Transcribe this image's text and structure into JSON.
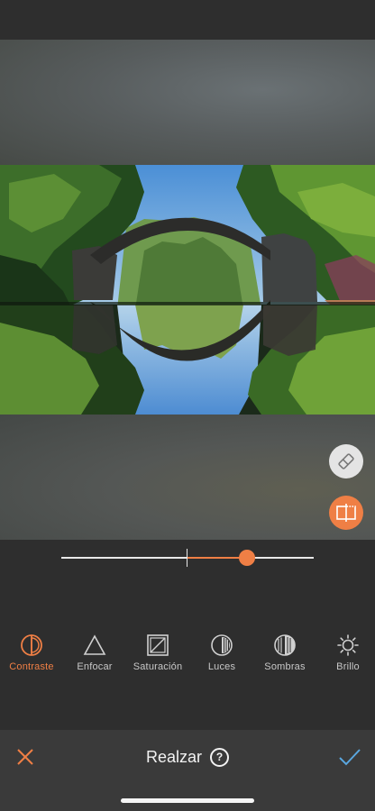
{
  "editor": {
    "photo_description": "stone arch bridge reflected in lake forming a circle",
    "slider": {
      "min": -1,
      "max": 1,
      "value": 0.47
    }
  },
  "tools": [
    {
      "label": "Contraste",
      "icon": "contrast-icon",
      "active": true
    },
    {
      "label": "Enfocar",
      "icon": "sharpen-triangle-icon",
      "active": false
    },
    {
      "label": "Saturación",
      "icon": "saturation-icon",
      "active": false
    },
    {
      "label": "Luces",
      "icon": "highlights-icon",
      "active": false
    },
    {
      "label": "Sombras",
      "icon": "shadows-icon",
      "active": false
    },
    {
      "label": "Brillo",
      "icon": "brightness-sun-icon",
      "active": false
    }
  ],
  "bottom_bar": {
    "title": "Realzar",
    "help": "?",
    "close_icon": "close-x-icon",
    "confirm_icon": "checkmark-icon"
  },
  "colors": {
    "accent": "#ef7f45",
    "confirm": "#5aa7e0",
    "background": "#2e2e2e",
    "toolbar": "#3a3a3a"
  }
}
